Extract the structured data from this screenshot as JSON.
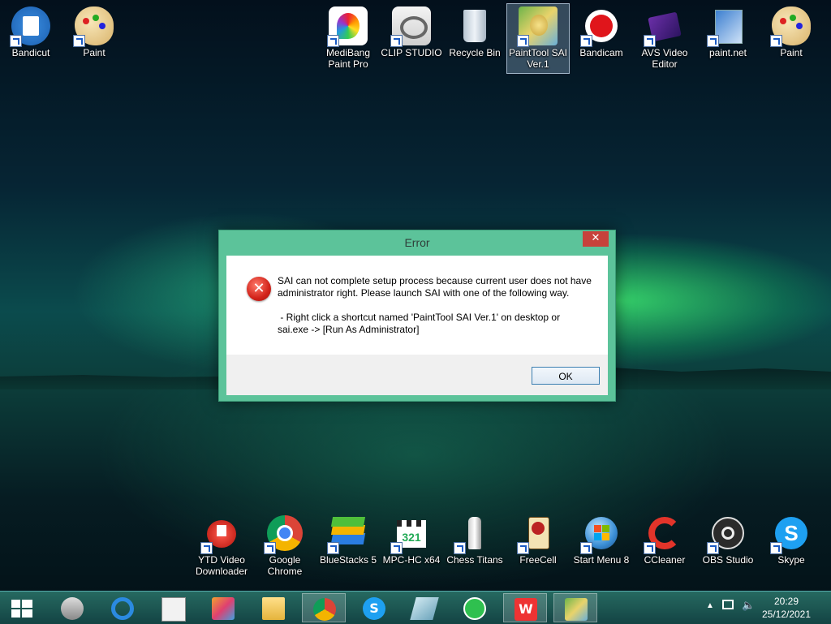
{
  "desktop_icons_top": [
    {
      "id": "bandicut",
      "label": "Bandicut"
    },
    {
      "id": "paint1",
      "label": "Paint"
    },
    {
      "id": "medibang",
      "label": "MediBang Paint Pro"
    },
    {
      "id": "clip",
      "label": "CLIP STUDIO"
    },
    {
      "id": "recycle",
      "label": "Recycle Bin"
    },
    {
      "id": "sai",
      "label": "PaintTool SAI Ver.1"
    },
    {
      "id": "bandicam",
      "label": "Bandicam"
    },
    {
      "id": "avs",
      "label": "AVS Video Editor"
    },
    {
      "id": "paintnet",
      "label": "paint.net"
    },
    {
      "id": "paint2",
      "label": "Paint"
    }
  ],
  "desktop_icons_bottom": [
    {
      "id": "ytd",
      "label": "YTD Video Downloader"
    },
    {
      "id": "chrome",
      "label": "Google Chrome"
    },
    {
      "id": "bluestacks",
      "label": "BlueStacks 5"
    },
    {
      "id": "mpc",
      "label": "MPC-HC x64"
    },
    {
      "id": "chess",
      "label": "Chess Titans"
    },
    {
      "id": "freecell",
      "label": "FreeCell"
    },
    {
      "id": "startmenu8",
      "label": "Start Menu 8"
    },
    {
      "id": "ccleaner",
      "label": "CCleaner"
    },
    {
      "id": "obs",
      "label": "OBS Studio"
    },
    {
      "id": "skype",
      "label": "Skype"
    }
  ],
  "dialog": {
    "title": "Error",
    "close_glyph": "✕",
    "line1": "SAI can not complete setup process because current user does not have",
    "line2": "administrator right. Please launch SAI with one of the following way.",
    "line3": " - Right click a shortcut named 'PaintTool SAI Ver.1' on desktop or",
    "line4": "sai.exe -> [Run As Administrator]",
    "ok_label": "OK"
  },
  "taskbar": {
    "start_icon": "windows-logo-icon",
    "time": "20:29",
    "date": "25/12/2021"
  },
  "colors": {
    "dialog_frame": "#5cc39a",
    "close_button": "#c7423b",
    "error_icon": "#d2231a",
    "taskbar": "#286e64"
  }
}
